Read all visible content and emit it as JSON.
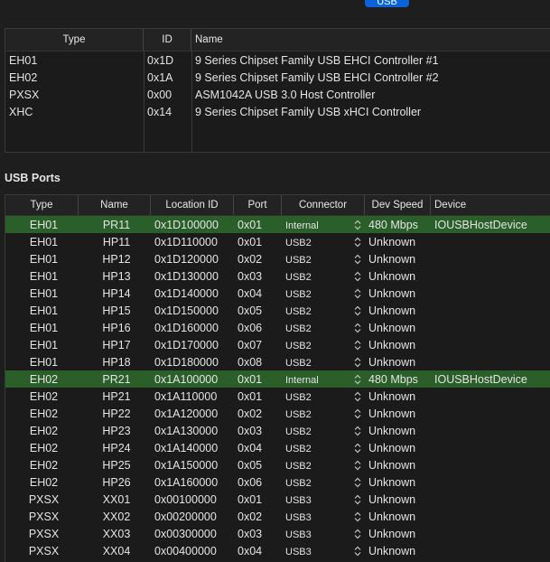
{
  "top_button": {
    "label": "USB"
  },
  "controllers": {
    "headers": {
      "type": "Type",
      "id": "ID",
      "name": "Name"
    },
    "rows": [
      {
        "type": "EH01",
        "id": "0x1D",
        "name": "9 Series Chipset Family USB EHCI Controller #1"
      },
      {
        "type": "EH02",
        "id": "0x1A",
        "name": "9 Series Chipset Family USB EHCI Controller #2"
      },
      {
        "type": "PXSX",
        "id": "0x00",
        "name": "ASM1042A USB 3.0 Host Controller"
      },
      {
        "type": "XHC",
        "id": "0x14",
        "name": "9 Series Chipset Family USB xHCI Controller"
      }
    ]
  },
  "usb_ports": {
    "title": "USB Ports",
    "headers": {
      "type": "Type",
      "name": "Name",
      "location": "Location ID",
      "port": "Port",
      "connector": "Connector",
      "speed": "Dev Speed",
      "device": "Device"
    },
    "rows": [
      {
        "type": "EH01",
        "name": "PR11",
        "location": "0x1D100000",
        "port": "0x01",
        "connector": "Internal",
        "speed": "480 Mbps",
        "device": "IOUSBHostDevice",
        "highlight": true
      },
      {
        "type": "EH01",
        "name": "HP11",
        "location": "0x1D110000",
        "port": "0x01",
        "connector": "USB2",
        "speed": "Unknown",
        "device": ""
      },
      {
        "type": "EH01",
        "name": "HP12",
        "location": "0x1D120000",
        "port": "0x02",
        "connector": "USB2",
        "speed": "Unknown",
        "device": ""
      },
      {
        "type": "EH01",
        "name": "HP13",
        "location": "0x1D130000",
        "port": "0x03",
        "connector": "USB2",
        "speed": "Unknown",
        "device": ""
      },
      {
        "type": "EH01",
        "name": "HP14",
        "location": "0x1D140000",
        "port": "0x04",
        "connector": "USB2",
        "speed": "Unknown",
        "device": ""
      },
      {
        "type": "EH01",
        "name": "HP15",
        "location": "0x1D150000",
        "port": "0x05",
        "connector": "USB2",
        "speed": "Unknown",
        "device": ""
      },
      {
        "type": "EH01",
        "name": "HP16",
        "location": "0x1D160000",
        "port": "0x06",
        "connector": "USB2",
        "speed": "Unknown",
        "device": ""
      },
      {
        "type": "EH01",
        "name": "HP17",
        "location": "0x1D170000",
        "port": "0x07",
        "connector": "USB2",
        "speed": "Unknown",
        "device": ""
      },
      {
        "type": "EH01",
        "name": "HP18",
        "location": "0x1D180000",
        "port": "0x08",
        "connector": "USB2",
        "speed": "Unknown",
        "device": ""
      },
      {
        "type": "EH02",
        "name": "PR21",
        "location": "0x1A100000",
        "port": "0x01",
        "connector": "Internal",
        "speed": "480 Mbps",
        "device": "IOUSBHostDevice",
        "highlight": true
      },
      {
        "type": "EH02",
        "name": "HP21",
        "location": "0x1A110000",
        "port": "0x01",
        "connector": "USB2",
        "speed": "Unknown",
        "device": ""
      },
      {
        "type": "EH02",
        "name": "HP22",
        "location": "0x1A120000",
        "port": "0x02",
        "connector": "USB2",
        "speed": "Unknown",
        "device": ""
      },
      {
        "type": "EH02",
        "name": "HP23",
        "location": "0x1A130000",
        "port": "0x03",
        "connector": "USB2",
        "speed": "Unknown",
        "device": ""
      },
      {
        "type": "EH02",
        "name": "HP24",
        "location": "0x1A140000",
        "port": "0x04",
        "connector": "USB2",
        "speed": "Unknown",
        "device": ""
      },
      {
        "type": "EH02",
        "name": "HP25",
        "location": "0x1A150000",
        "port": "0x05",
        "connector": "USB2",
        "speed": "Unknown",
        "device": ""
      },
      {
        "type": "EH02",
        "name": "HP26",
        "location": "0x1A160000",
        "port": "0x06",
        "connector": "USB2",
        "speed": "Unknown",
        "device": ""
      },
      {
        "type": "PXSX",
        "name": "XX01",
        "location": "0x00100000",
        "port": "0x01",
        "connector": "USB3",
        "speed": "Unknown",
        "device": ""
      },
      {
        "type": "PXSX",
        "name": "XX02",
        "location": "0x00200000",
        "port": "0x02",
        "connector": "USB3",
        "speed": "Unknown",
        "device": ""
      },
      {
        "type": "PXSX",
        "name": "XX03",
        "location": "0x00300000",
        "port": "0x03",
        "connector": "USB3",
        "speed": "Unknown",
        "device": ""
      },
      {
        "type": "PXSX",
        "name": "XX04",
        "location": "0x00400000",
        "port": "0x04",
        "connector": "USB3",
        "speed": "Unknown",
        "device": ""
      }
    ]
  },
  "colors": {
    "highlight": "#2a5f2a",
    "accent": "#0a63d8",
    "background": "#1e1e1e"
  }
}
